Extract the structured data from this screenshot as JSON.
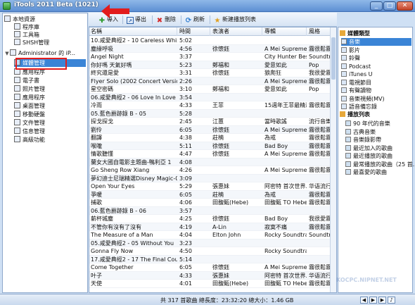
{
  "window": {
    "title": "iTools 2011 Beta (1021)",
    "min": "_",
    "max": "□",
    "close": "✕"
  },
  "left_tree": [
    {
      "label": "本地資源",
      "indent": 0,
      "icon": "computer-icon",
      "expander": ""
    },
    {
      "label": "程序庫",
      "indent": 1,
      "icon": "folder-icon",
      "expander": ""
    },
    {
      "label": "工具箱",
      "indent": 1,
      "icon": "toolbox-icon",
      "expander": ""
    },
    {
      "label": "SHSH管理",
      "indent": 1,
      "icon": "shsh-icon",
      "expander": ""
    },
    {
      "label": "Administrator 的 iP...",
      "indent": 0,
      "icon": "iphone-icon",
      "expander": "▼"
    },
    {
      "label": "媒體管理",
      "indent": 1,
      "icon": "media-icon",
      "expander": "",
      "selected": true
    },
    {
      "label": "應用程序",
      "indent": 1,
      "icon": "apps-icon",
      "expander": ""
    },
    {
      "label": "電子書",
      "indent": 1,
      "icon": "ebook-icon",
      "expander": ""
    },
    {
      "label": "照片管理",
      "indent": 1,
      "icon": "photo-icon",
      "expander": ""
    },
    {
      "label": "應用程序",
      "indent": 1,
      "icon": "apps-icon",
      "expander": ""
    },
    {
      "label": "桌面管理",
      "indent": 1,
      "icon": "desktop-icon",
      "expander": ""
    },
    {
      "label": "移動硬盤",
      "indent": 1,
      "icon": "disk-icon",
      "expander": ""
    },
    {
      "label": "文件管理",
      "indent": 1,
      "icon": "file-icon",
      "expander": ""
    },
    {
      "label": "信息管理",
      "indent": 1,
      "icon": "message-icon",
      "expander": ""
    },
    {
      "label": "高級功能",
      "indent": 1,
      "icon": "star-icon",
      "expander": ""
    }
  ],
  "toolbar": {
    "import": "導入",
    "export": "導出",
    "delete": "刪除",
    "refresh": "刷新",
    "new_playlist": "新建播放列表"
  },
  "grid": {
    "columns": [
      "名稱",
      "時間",
      "表演者",
      "專輯",
      "風格"
    ],
    "rows": [
      [
        "10.咸愛典經2 - 10 Careless Whisper",
        "5:02",
        "",
        "",
        ""
      ],
      [
        "塵緣呼吸",
        "4:56",
        "徐懷鈺",
        "A Mei Supreme E...",
        "霧很鬆霧很阿(ヨ"
      ],
      [
        "Angel Night",
        "3:37",
        "",
        "City Hunter Best C...",
        "Soundtrack"
      ],
      [
        "你好嗎 天氣好嗎",
        "5:23",
        "鄭福和",
        "愛意如此",
        "Pop"
      ],
      [
        "終究還是愛",
        "3:31",
        "徐懷鈺",
        "狼爬狂",
        "我很愛霧很鬆阿"
      ],
      [
        "Flyer Solo (2002 Concert Version)",
        "2:26",
        "",
        "A Mei Supreme E...",
        "霧很鬆霧很阿(ヨ"
      ],
      [
        "星空密碼",
        "3:10",
        "鄭福和",
        "愛意如此",
        "Pop"
      ],
      [
        "06.咸愛典經2 - 06 Love In Love",
        "3:54",
        "",
        "",
        ""
      ],
      [
        "冷雨",
        "4:33",
        "王菲",
        "15週年王菲最精選...",
        "霧很鬆霧很阿(ヨ"
      ],
      [
        "05.藍色爵跡錄 B - 05",
        "5:28",
        "",
        "",
        ""
      ],
      [
        "探戈探戈",
        "2:45",
        "江蕙",
        "當時歌謠",
        "流行音樂 [流"
      ],
      [
        "劉伶",
        "6:05",
        "徐懷鈺",
        "A Mei Supreme E...",
        "霧很鬆霧很阿(ヨ"
      ],
      [
        "翻譯",
        "4:38",
        "莊楠",
        "為戒",
        "霧很鬆霧很阿(ヨ"
      ],
      [
        "喉嚨",
        "5:11",
        "徐懷鈺",
        "Bad Boy",
        "霧很鬆霧很阿(ヨ"
      ],
      [
        "情歌聽懂",
        "4:47",
        "徐懷鈺",
        "A Mei Supreme E...",
        "霧很鬆霧很阿(ヨ"
      ],
      [
        "蘭女大國自電影主題曲-鴨利亞 1",
        "4:08",
        "",
        "",
        ""
      ],
      [
        "Go Sheng Row Xiang",
        "4:26",
        "",
        "A Mei Supreme E...",
        "霧很鬆霧很阿(ヨ"
      ],
      [
        "夢幻迪士尼瑞精選Disney Magic-09-stran...",
        "3:09",
        "",
        "",
        ""
      ],
      [
        "Open Your Eyes",
        "5:29",
        "張惠妹",
        "阿密特 首次世界...",
        "华语流行音"
      ],
      [
        "爭暖",
        "6:05",
        "莊楠",
        "為戒",
        "霧很鬆霧很阿(ヨ"
      ],
      [
        "捕歌",
        "4:06",
        "田馥甄(Hebe)",
        "田馥甄 TO Hebe ...",
        "霧很鬆霧很阿(ヨ"
      ],
      [
        "06.藍色爵跡錄 B - 06",
        "3:57",
        "",
        "",
        ""
      ],
      [
        "薪杯城塵",
        "4:25",
        "徐懷鈺",
        "Bad Boy",
        "我很愛霧很鬆阿"
      ],
      [
        "不管你有沒有了沒有",
        "4:19",
        "A-Lin",
        "寂寞不痛",
        "霧很鬆霧很阿(ヨ"
      ],
      [
        "The Measure of a Man",
        "4:04",
        "Elton John",
        "Rocky Soundtrack",
        "Soundtrack"
      ],
      [
        "05.咸愛典經2 - 05 Without You",
        "3:23",
        "",
        "",
        ""
      ],
      [
        "Gonna Fly Now",
        "4:50",
        "",
        "Rocky Soundtrack",
        ""
      ],
      [
        "17.咸愛典經2 - 17 The Final Countdown",
        "5:14",
        "",
        "",
        ""
      ],
      [
        "Come Together",
        "6:05",
        "徐懷鈺",
        "A Mei Supreme E...",
        "霧很鬆霧很阿(ヨ"
      ],
      [
        "叶子",
        "4:33",
        "張惠妹",
        "阿密特 首次世界...",
        "华语流行音"
      ],
      [
        "天使",
        "4:01",
        "田馥甄(Hebe)",
        "田馥甄 TO Hebe ...",
        "霧很鬆霧很阿(ヨ"
      ]
    ]
  },
  "right_panel": {
    "media_head": "媒體類型",
    "media": [
      {
        "label": "音樂",
        "icon": "music-icon",
        "selected": true
      },
      {
        "label": "影片",
        "icon": "movie-icon"
      },
      {
        "label": "鈴聲",
        "icon": "ringtone-icon"
      },
      {
        "label": "Podcast",
        "icon": "podcast-icon"
      },
      {
        "label": "iTunes U",
        "icon": "itunes-u-icon"
      },
      {
        "label": "電視節目",
        "icon": "tv-icon"
      },
      {
        "label": "有聲讀物",
        "icon": "audiobook-icon"
      },
      {
        "label": "音樂視頻(MV)",
        "icon": "mv-icon"
      },
      {
        "label": "語音備忘錄",
        "icon": "voice-memo-icon"
      }
    ],
    "playlist_head": "播放列表",
    "playlists": [
      {
        "label": "90 年代的音樂"
      },
      {
        "label": "古典音樂"
      },
      {
        "label": "音樂錄影帶"
      },
      {
        "label": "最近加入的歌曲"
      },
      {
        "label": "最近播放的歌曲"
      },
      {
        "label": "最常播放的歌曲（25 首..."
      },
      {
        "label": "最喜愛的歌曲"
      }
    ]
  },
  "status": {
    "text": "共 317 首歌曲    總長度：23:32:20    總大小：1.46 GB"
  },
  "watermark": "KOCPC.NIPNET.NET"
}
